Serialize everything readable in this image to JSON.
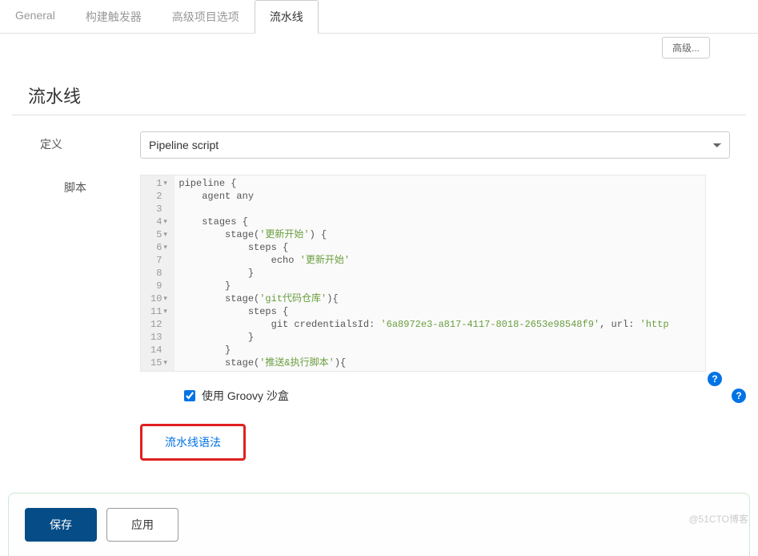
{
  "tabs": {
    "items": [
      {
        "label": "General",
        "active": false
      },
      {
        "label": "构建触发器",
        "active": false
      },
      {
        "label": "高级项目选项",
        "active": false
      },
      {
        "label": "流水线",
        "active": true
      }
    ]
  },
  "top_button": "高级...",
  "section_title": "流水线",
  "definition": {
    "label": "定义",
    "selected": "Pipeline script"
  },
  "script": {
    "label": "脚本",
    "lines": [
      {
        "n": 1,
        "fold": true,
        "indent": 0,
        "tokens": [
          {
            "t": "pipeline {",
            "c": "kw"
          }
        ]
      },
      {
        "n": 2,
        "fold": false,
        "indent": 1,
        "tokens": [
          {
            "t": "agent any",
            "c": "kw"
          }
        ]
      },
      {
        "n": 3,
        "fold": false,
        "indent": 0,
        "tokens": []
      },
      {
        "n": 4,
        "fold": true,
        "indent": 1,
        "tokens": [
          {
            "t": "stages {",
            "c": "kw"
          }
        ]
      },
      {
        "n": 5,
        "fold": true,
        "indent": 2,
        "tokens": [
          {
            "t": "stage(",
            "c": "kw"
          },
          {
            "t": "'更新开始'",
            "c": "str"
          },
          {
            "t": ") {",
            "c": "kw"
          }
        ]
      },
      {
        "n": 6,
        "fold": true,
        "indent": 3,
        "tokens": [
          {
            "t": "steps {",
            "c": "kw"
          }
        ]
      },
      {
        "n": 7,
        "fold": false,
        "indent": 4,
        "tokens": [
          {
            "t": "echo ",
            "c": "kw"
          },
          {
            "t": "'更新开始'",
            "c": "str"
          }
        ]
      },
      {
        "n": 8,
        "fold": false,
        "indent": 3,
        "tokens": [
          {
            "t": "}",
            "c": "kw"
          }
        ]
      },
      {
        "n": 9,
        "fold": false,
        "indent": 2,
        "tokens": [
          {
            "t": "}",
            "c": "kw"
          }
        ]
      },
      {
        "n": 10,
        "fold": true,
        "indent": 2,
        "tokens": [
          {
            "t": "stage(",
            "c": "kw"
          },
          {
            "t": "'git代码仓库'",
            "c": "str"
          },
          {
            "t": "){",
            "c": "kw"
          }
        ]
      },
      {
        "n": 11,
        "fold": true,
        "indent": 3,
        "tokens": [
          {
            "t": "steps {",
            "c": "kw"
          }
        ]
      },
      {
        "n": 12,
        "fold": false,
        "indent": 4,
        "tokens": [
          {
            "t": "git credentialsId: ",
            "c": "kw"
          },
          {
            "t": "'6a8972e3-a817-4117-8018-2653e98548f9'",
            "c": "str"
          },
          {
            "t": ", url: ",
            "c": "kw"
          },
          {
            "t": "'http",
            "c": "str"
          }
        ]
      },
      {
        "n": 13,
        "fold": false,
        "indent": 3,
        "tokens": [
          {
            "t": "}",
            "c": "kw"
          }
        ]
      },
      {
        "n": 14,
        "fold": false,
        "indent": 2,
        "tokens": [
          {
            "t": "}",
            "c": "kw"
          }
        ]
      },
      {
        "n": 15,
        "fold": true,
        "indent": 2,
        "tokens": [
          {
            "t": "stage(",
            "c": "kw"
          },
          {
            "t": "'推送&执行脚本'",
            "c": "str"
          },
          {
            "t": "){",
            "c": "kw"
          }
        ]
      }
    ]
  },
  "sandbox": {
    "label": "使用 Groovy 沙盒",
    "checked": true
  },
  "syntax_link": "流水线语法",
  "footer": {
    "save": "保存",
    "apply": "应用"
  },
  "watermark": "@51CTO博客"
}
